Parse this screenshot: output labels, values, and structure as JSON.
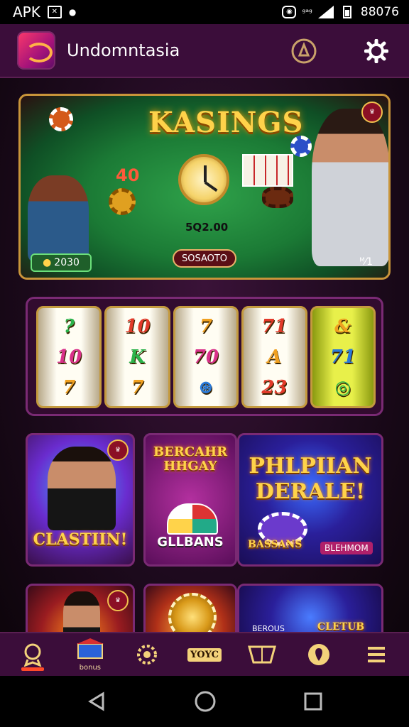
{
  "status_bar": {
    "left_label": "APK",
    "time": "88076",
    "small_glyph": "ᵍᵃᵍ"
  },
  "header": {
    "title": "Undomntasia"
  },
  "hero": {
    "title": "KASINGS",
    "bet_number": "40",
    "table_text": "5Q2.00",
    "left_pill": "2030",
    "mid_pill": "SOSAOTO",
    "corner_text": "ᴹ⁄1"
  },
  "slot": {
    "reels": [
      [
        "?",
        "10",
        "7"
      ],
      [
        "10",
        "K",
        "7"
      ],
      [
        "7",
        "70",
        "⊛"
      ],
      [
        "71",
        "A",
        "23"
      ],
      [
        "&",
        "71",
        "◎"
      ]
    ]
  },
  "tiles": {
    "tile_a_text": "CLASTIIN!",
    "tile_b_title": "BERCAHR HHGAY",
    "tile_b_sub": "GLLBANS",
    "tile_c_title": "PHLPIIAN DERALE!",
    "tile_c_sub": "BASSANS",
    "tile_c_tag": "BLEHMOM",
    "tile_f_sub": "BEROUS",
    "tile_f_tag": "CLETUB"
  },
  "bottom_nav": {
    "items": [
      {
        "icon": "trophy-icon",
        "active": true
      },
      {
        "icon": "treasure-chest-icon",
        "caption": "bonus"
      },
      {
        "icon": "gear-badge-icon"
      },
      {
        "icon": "tag-icon",
        "text": "YOYC"
      },
      {
        "icon": "basket-icon"
      },
      {
        "icon": "location-icon"
      },
      {
        "icon": "menu-icon"
      }
    ]
  },
  "colors": {
    "header_bg": "#3b0d3a",
    "gold": "#ffd34a",
    "accent_red": "#ff4a2a"
  }
}
